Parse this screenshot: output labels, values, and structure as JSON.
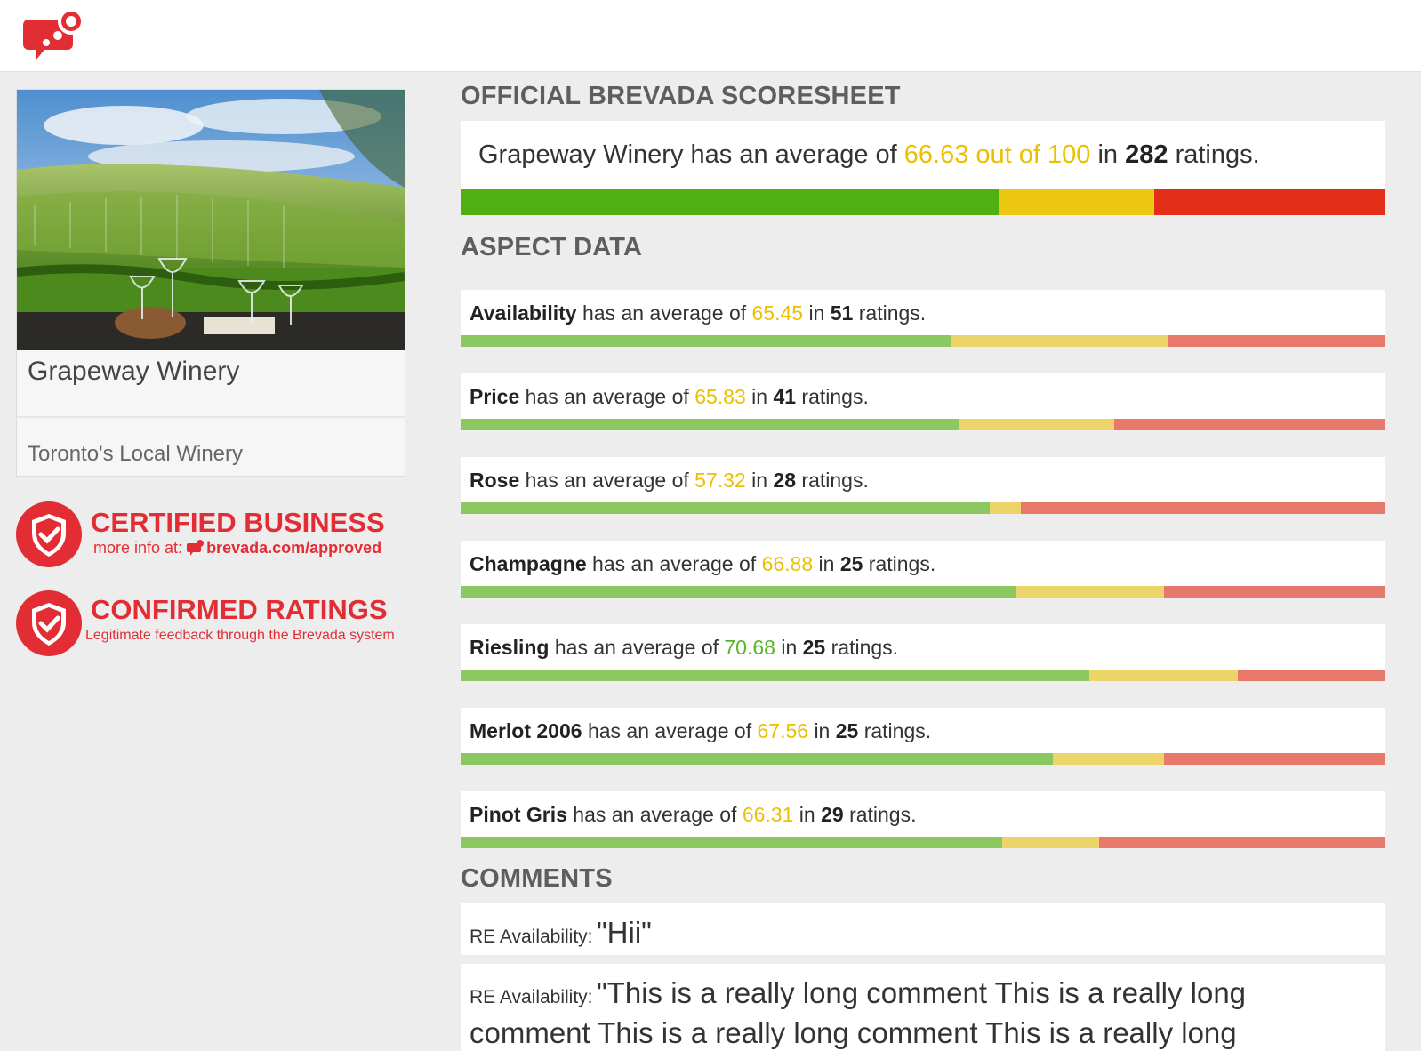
{
  "header": {
    "logo_icon": "brevada-speech-bubble-logo"
  },
  "business": {
    "name": "Grapeway Winery",
    "tagline": "Toronto's Local Winery",
    "photo_icon": "vineyard-photo"
  },
  "badges": [
    {
      "title": "CERTIFIED BUSINESS",
      "sub_prefix": "more info at:",
      "sub_link": "brevada.com/approved"
    },
    {
      "title": "CONFIRMED RATINGS",
      "sub": "Legitimate feedback through the Brevada system"
    }
  ],
  "scoresheet": {
    "heading": "OFFICIAL BREVADA SCORESHEET",
    "business": "Grapeway Winery",
    "pre": "has an average of",
    "score_text": "66.63 out of 100",
    "mid": "in",
    "count": "282",
    "post": "ratings.",
    "bar": [
      0.582,
      0.168,
      0.25
    ]
  },
  "aspects_heading": "ASPECT DATA",
  "aspects": [
    {
      "name": "Availability",
      "avg": "65.45",
      "count": "51",
      "value_color": "yellow",
      "bar": [
        0.53,
        0.235,
        0.235
      ]
    },
    {
      "name": "Price",
      "avg": "65.83",
      "count": "41",
      "value_color": "yellow",
      "bar": [
        0.538,
        0.169,
        0.293
      ]
    },
    {
      "name": "Rose",
      "avg": "57.32",
      "count": "28",
      "value_color": "yellow",
      "bar": [
        0.572,
        0.034,
        0.394
      ]
    },
    {
      "name": "Champagne",
      "avg": "66.88",
      "count": "25",
      "value_color": "yellow",
      "bar": [
        0.601,
        0.16,
        0.239
      ]
    },
    {
      "name": "Riesling",
      "avg": "70.68",
      "count": "25",
      "value_color": "green",
      "bar": [
        0.68,
        0.16,
        0.16
      ]
    },
    {
      "name": "Merlot 2006",
      "avg": "67.56",
      "count": "25",
      "value_color": "yellow",
      "bar": [
        0.64,
        0.121,
        0.239
      ]
    },
    {
      "name": "Pinot Gris",
      "avg": "66.31",
      "count": "29",
      "value_color": "yellow",
      "bar": [
        0.586,
        0.104,
        0.31
      ]
    }
  ],
  "aspect_phrase": {
    "pre": "has an average of",
    "mid": "in",
    "post": "ratings."
  },
  "comments_heading": "COMMENTS",
  "comments": [
    {
      "re": "RE Availability:",
      "text": "\"Hii\""
    },
    {
      "re": "RE Availability:",
      "text": "\"This is a really long comment This is a really long comment This is a really long comment This is a really long"
    }
  ],
  "colors": {
    "main_green": "#4faf13",
    "main_yellow": "#ecc811",
    "main_red": "#e32f18",
    "light_green": "#8bc862",
    "light_yellow": "#ecd468",
    "light_red": "#e8786a",
    "brand_red": "#e32d35",
    "score_yellow": "#ebc000",
    "score_green": "#58b527"
  }
}
